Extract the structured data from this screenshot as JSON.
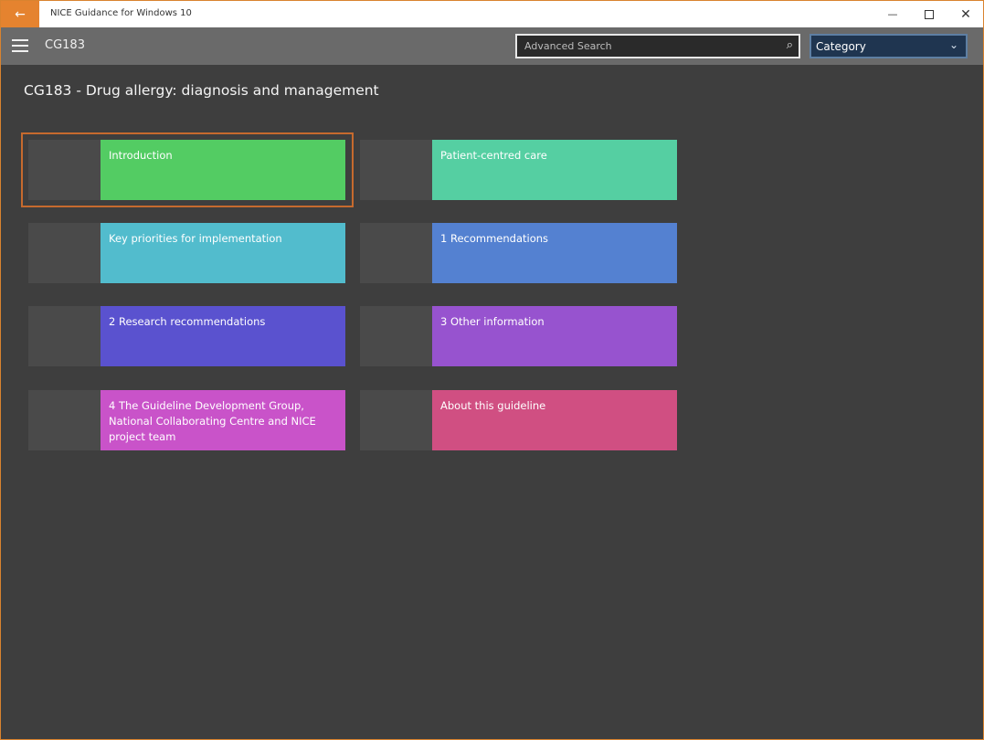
{
  "window": {
    "title": "NICE Guidance for Windows 10",
    "back_glyph": "←",
    "minimize_glyph": "—",
    "close_glyph": "✕"
  },
  "nav": {
    "code": "CG183",
    "search_placeholder": "Advanced Search",
    "search_glyph": "⌕",
    "category_label": "Category",
    "chevron_glyph": "⌄"
  },
  "page": {
    "title": "CG183 - Drug allergy: diagnosis and management"
  },
  "tiles": [
    {
      "label": "Introduction",
      "color": "#53cc63"
    },
    {
      "label": "Patient-centred care",
      "color": "#55cfa2"
    },
    {
      "label": "Key priorities for implementation",
      "color": "#52bccd"
    },
    {
      "label": "1 Recommendations",
      "color": "#5481d1"
    },
    {
      "label": "2 Research recommendations",
      "color": "#5a52cf"
    },
    {
      "label": "3 Other information",
      "color": "#9753cf"
    },
    {
      "label": "4 The Guideline Development Group, National Collaborating Centre and NICE project team",
      "color": "#c953c9"
    },
    {
      "label": "About this guideline",
      "color": "#d04f82"
    }
  ],
  "colors": {
    "accent": "#e5832f",
    "focus_outline": "#c66a2e",
    "background": "#3e3e3e",
    "navbar": "#6a6a6a"
  }
}
